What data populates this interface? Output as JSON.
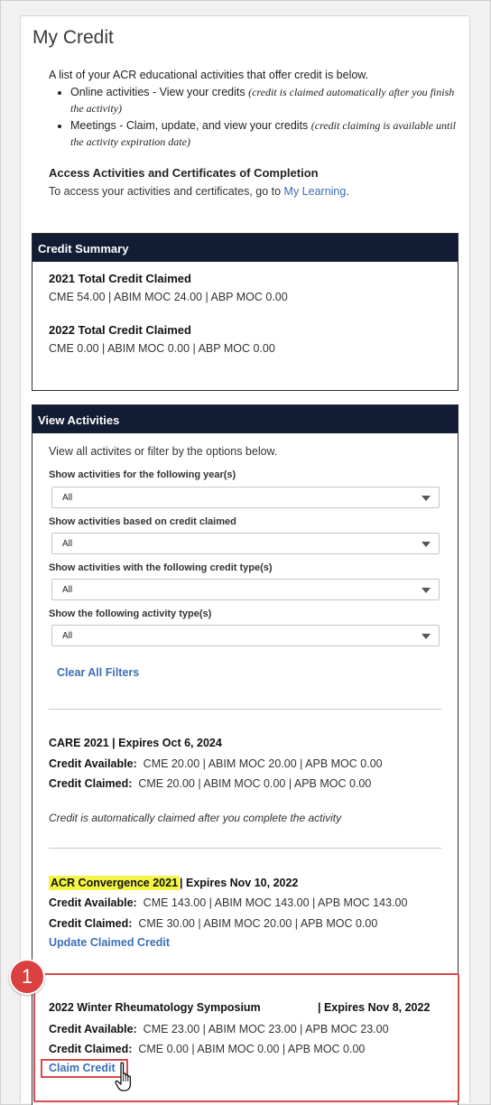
{
  "page": {
    "title": "My Credit",
    "intro": "A list of your ACR educational activities that offer credit is below.",
    "bullets": [
      {
        "text": "Online activities - View your credits",
        "note": "(credit is claimed automatically after you finish the activity)"
      },
      {
        "text": "Meetings - Claim, update, and view your credits",
        "note": "(credit claiming is available until the activity expiration date)"
      }
    ],
    "access_title": "Access Activities and Certificates of Completion",
    "access_text": "To access your activities and certificates, go to",
    "access_link": "My Learning",
    "access_period": "."
  },
  "summary": {
    "header": "Credit Summary",
    "years": [
      {
        "title": "2021 Total Credit Claimed",
        "line": "CME 54.00 | ABIM MOC 24.00 | ABP MOC 0.00"
      },
      {
        "title": "2022 Total Credit Claimed",
        "line": "CME 0.00 | ABIM MOC 0.00 | ABP MOC 0.00"
      }
    ]
  },
  "activities": {
    "header": "View Activities",
    "intro": "View all activites or filter by the options below.",
    "filters": [
      {
        "label": "Show activities for the following year(s)",
        "value": "All"
      },
      {
        "label": "Show activities based on credit claimed",
        "value": "All"
      },
      {
        "label": "Show activities with the following credit type(s)",
        "value": "All"
      },
      {
        "label": "Show the following activity type(s)",
        "value": "All"
      }
    ],
    "clear_filters": "Clear All Filters",
    "items": [
      {
        "title": "CARE 2021 | Expires Oct 6, 2024",
        "available_label": "Credit Available:",
        "available": "CME 20.00 | ABIM MOC 20.00 | APB MOC 0.00",
        "claimed_label": "Credit Claimed:",
        "claimed": "CME 20.00 | ABIM MOC 0.00 | APB MOC 0.00",
        "note": "Credit is automatically claimed after you complete the activity"
      },
      {
        "title_highlight": "ACR Convergence 2021",
        "title_rest": "| Expires Nov 10, 2022",
        "available_label": "Credit Available:",
        "available": "CME 143.00 | ABIM MOC 143.00 | APB MOC 143.00",
        "claimed_label": "Credit Claimed:",
        "claimed": "CME 30.00 | ABIM MOC 20.00 | APB MOC 0.00",
        "action": "Update Claimed Credit"
      },
      {
        "title": "2022 Winter Rheumatology Symposium",
        "expires": "| Expires Nov 8, 2022",
        "available_label": "Credit Available:",
        "available": "CME 23.00 | ABIM MOC 23.00 | APB MOC 23.00",
        "claimed_label": "Credit Claimed:",
        "claimed": "CME 0.00 | ABIM MOC 0.00 | APB MOC 0.00",
        "action": "Claim Credit"
      }
    ]
  },
  "annotation": {
    "step": "1",
    "color": "#d9403f"
  }
}
